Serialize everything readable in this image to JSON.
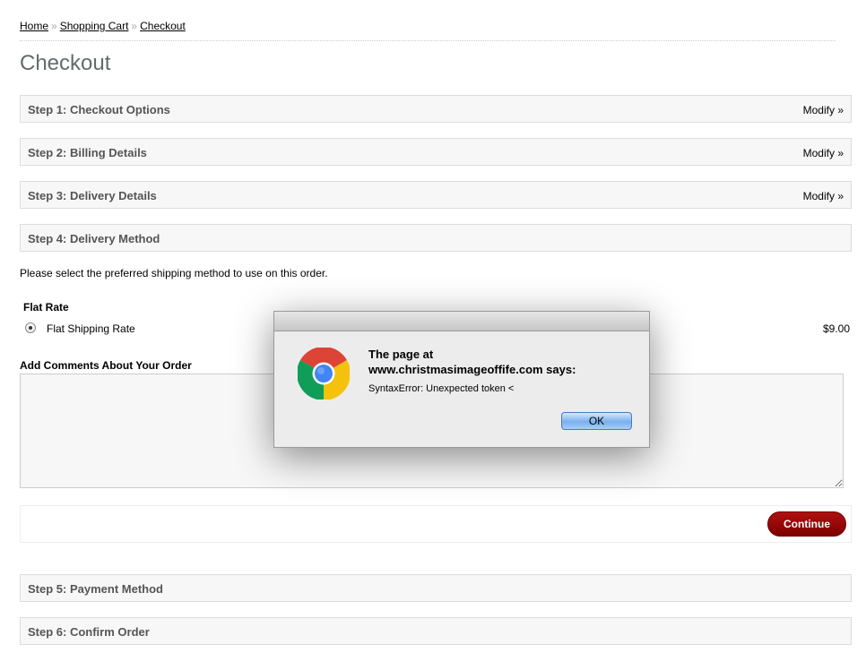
{
  "breadcrumb": {
    "items": [
      "Home",
      "Shopping Cart",
      "Checkout"
    ],
    "separator": "»"
  },
  "page": {
    "title": "Checkout"
  },
  "steps": [
    {
      "title": "Step 1: Checkout Options",
      "modify": "Modify »"
    },
    {
      "title": "Step 2: Billing Details",
      "modify": "Modify »"
    },
    {
      "title": "Step 3: Delivery Details",
      "modify": "Modify »"
    },
    {
      "title": "Step 4: Delivery Method"
    },
    {
      "title": "Step 5: Payment Method"
    },
    {
      "title": "Step 6: Confirm Order"
    }
  ],
  "delivery": {
    "instruction": "Please select the preferred shipping method to use on this order.",
    "method_title": "Flat Rate",
    "option_label": "Flat Shipping Rate",
    "option_price": "$9.00",
    "option_selected": true,
    "comments_title": "Add Comments About Your Order",
    "comments_value": "",
    "continue_label": "Continue"
  },
  "dialog": {
    "heading_line1": "The page at",
    "heading_line2": "www.christmasimageoffife.com says:",
    "message": "SyntaxError: Unexpected token <",
    "ok_label": "OK",
    "icon": "chrome-icon"
  },
  "colors": {
    "continue_button": "#9b0a0a",
    "ok_button": "#79b0ee",
    "step_header_bg": "#f7f7f7"
  }
}
